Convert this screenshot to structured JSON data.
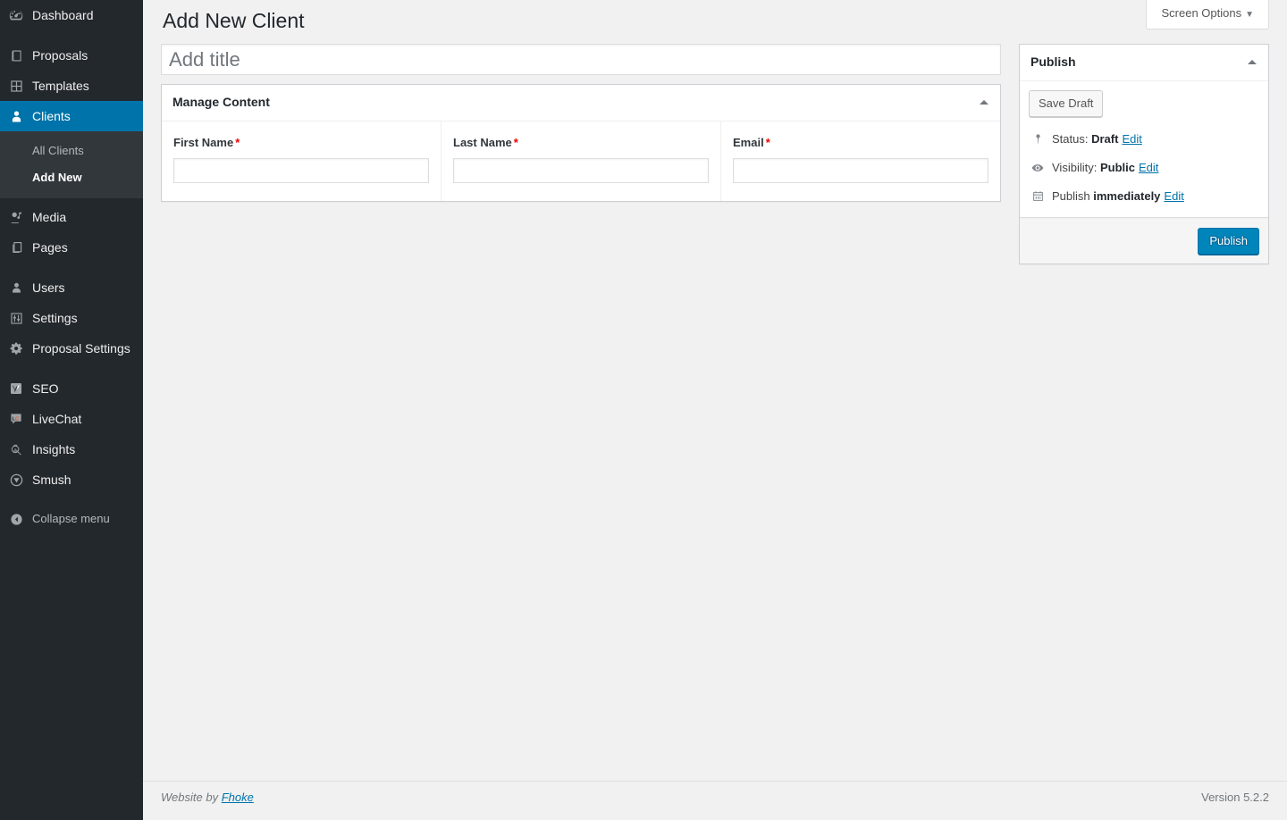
{
  "sidebar": {
    "items": [
      {
        "label": "Dashboard",
        "icon": "dashboard-icon",
        "current": false
      },
      {
        "label": "Proposals",
        "icon": "book-icon",
        "current": false,
        "separator_before": true
      },
      {
        "label": "Templates",
        "icon": "grid-icon",
        "current": false
      },
      {
        "label": "Clients",
        "icon": "user-icon",
        "current": true
      },
      {
        "label": "Media",
        "icon": "media-icon",
        "current": false
      },
      {
        "label": "Pages",
        "icon": "pages-icon",
        "current": false
      },
      {
        "label": "Users",
        "icon": "users-icon",
        "current": false,
        "separator_before": true
      },
      {
        "label": "Settings",
        "icon": "sliders-icon",
        "current": false
      },
      {
        "label": "Proposal Settings",
        "icon": "gear-icon",
        "current": false
      },
      {
        "label": "SEO",
        "icon": "yoast-seo-icon",
        "current": false,
        "separator_before": true
      },
      {
        "label": "LiveChat",
        "icon": "livechat-icon",
        "current": false
      },
      {
        "label": "Insights",
        "icon": "insights-icon",
        "current": false
      },
      {
        "label": "Smush",
        "icon": "smush-icon",
        "current": false
      }
    ],
    "submenu": [
      {
        "label": "All Clients",
        "current": false
      },
      {
        "label": "Add New",
        "current": true
      }
    ],
    "collapse": {
      "label": "Collapse menu",
      "icon": "collapse-arrow-icon"
    }
  },
  "screen_meta": {
    "screen_options_label": "Screen Options",
    "caret": "▼"
  },
  "page": {
    "title": "Add New Client"
  },
  "title_field": {
    "value": "",
    "placeholder": "Add title"
  },
  "manage_content": {
    "heading": "Manage Content",
    "toggle_icon": "chevron-up-icon",
    "fields": [
      {
        "label": "First Name",
        "required": "*",
        "value": "",
        "name": "first-name"
      },
      {
        "label": "Last Name",
        "required": "*",
        "value": "",
        "name": "last-name"
      },
      {
        "label": "Email",
        "required": "*",
        "value": "",
        "name": "email"
      }
    ]
  },
  "publish_box": {
    "heading": "Publish",
    "toggle_icon": "chevron-up-icon",
    "save_draft_label": "Save Draft",
    "status": {
      "icon": "post-status-icon",
      "prefix": "Status:",
      "value": "Draft",
      "edit_label": "Edit"
    },
    "visibility": {
      "icon": "visibility-eye-icon",
      "prefix": "Visibility:",
      "value": "Public",
      "edit_label": "Edit"
    },
    "schedule": {
      "icon": "calendar-icon",
      "prefix": "Publish",
      "value": "immediately",
      "edit_label": "Edit"
    },
    "publish_label": "Publish"
  },
  "footer": {
    "left_prefix": "Website by",
    "left_link": "Fhoke",
    "right": "Version 5.2.2"
  },
  "colors": {
    "sidebar_bg": "#23282d",
    "submenu_bg": "#32373c",
    "accent": "#0073aa",
    "primary_button": "#0085ba",
    "required_star": "#e00000",
    "content_bg": "#f1f1f1"
  }
}
